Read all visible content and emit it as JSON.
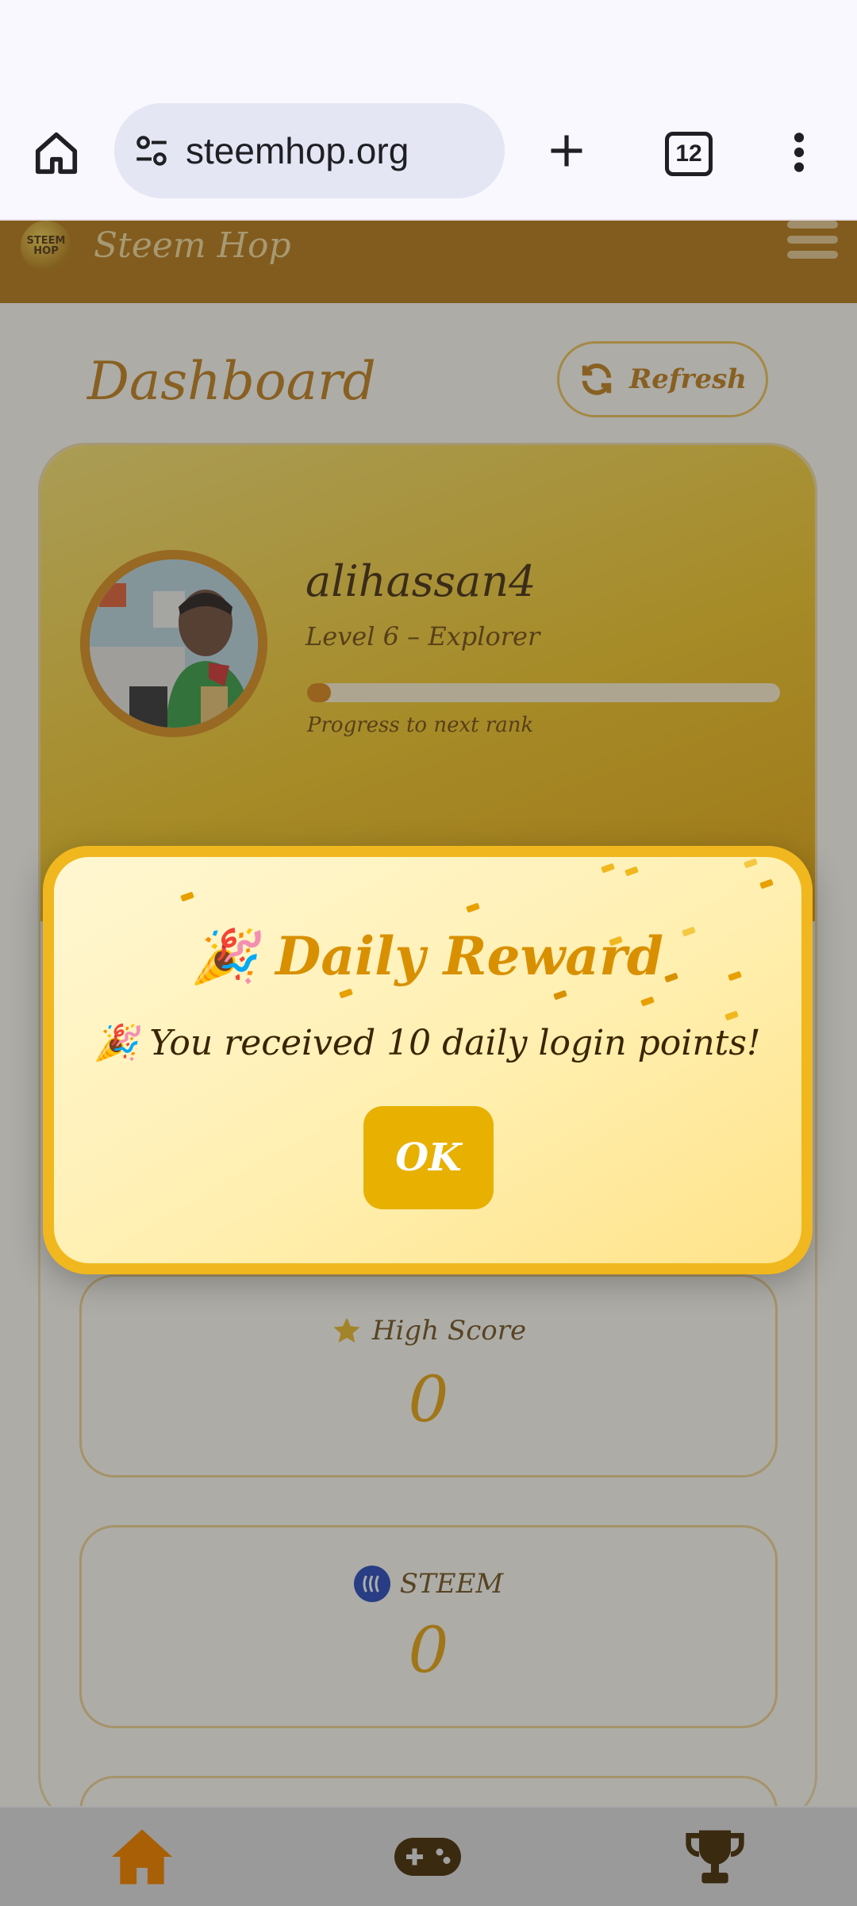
{
  "browser": {
    "url": "steemhop.org",
    "tab_count": "12"
  },
  "site": {
    "brand": "Steem Hop",
    "logo_text": "STEEM HOP"
  },
  "dashboard": {
    "title": "Dashboard",
    "refresh_label": "Refresh"
  },
  "profile": {
    "username": "alihassan4",
    "level": "Level 6 – Explorer",
    "progress_label": "Progress to next rank",
    "progress_fraction": 0.05
  },
  "stats": [
    {
      "label": "High Score",
      "value": "0",
      "icon": "star-icon"
    },
    {
      "label": "STEEM",
      "value": "0",
      "icon": "steem-icon"
    }
  ],
  "modal": {
    "title": "Daily Reward",
    "message": "You received 10 daily login points!",
    "ok_label": "OK",
    "emoji": "🎉"
  },
  "bottom_nav": [
    {
      "name": "home-icon"
    },
    {
      "name": "gamepad-icon"
    },
    {
      "name": "trophy-icon"
    }
  ],
  "colors": {
    "header": "#b67409",
    "accent": "#e8b000",
    "text_brown": "#c07a10"
  }
}
